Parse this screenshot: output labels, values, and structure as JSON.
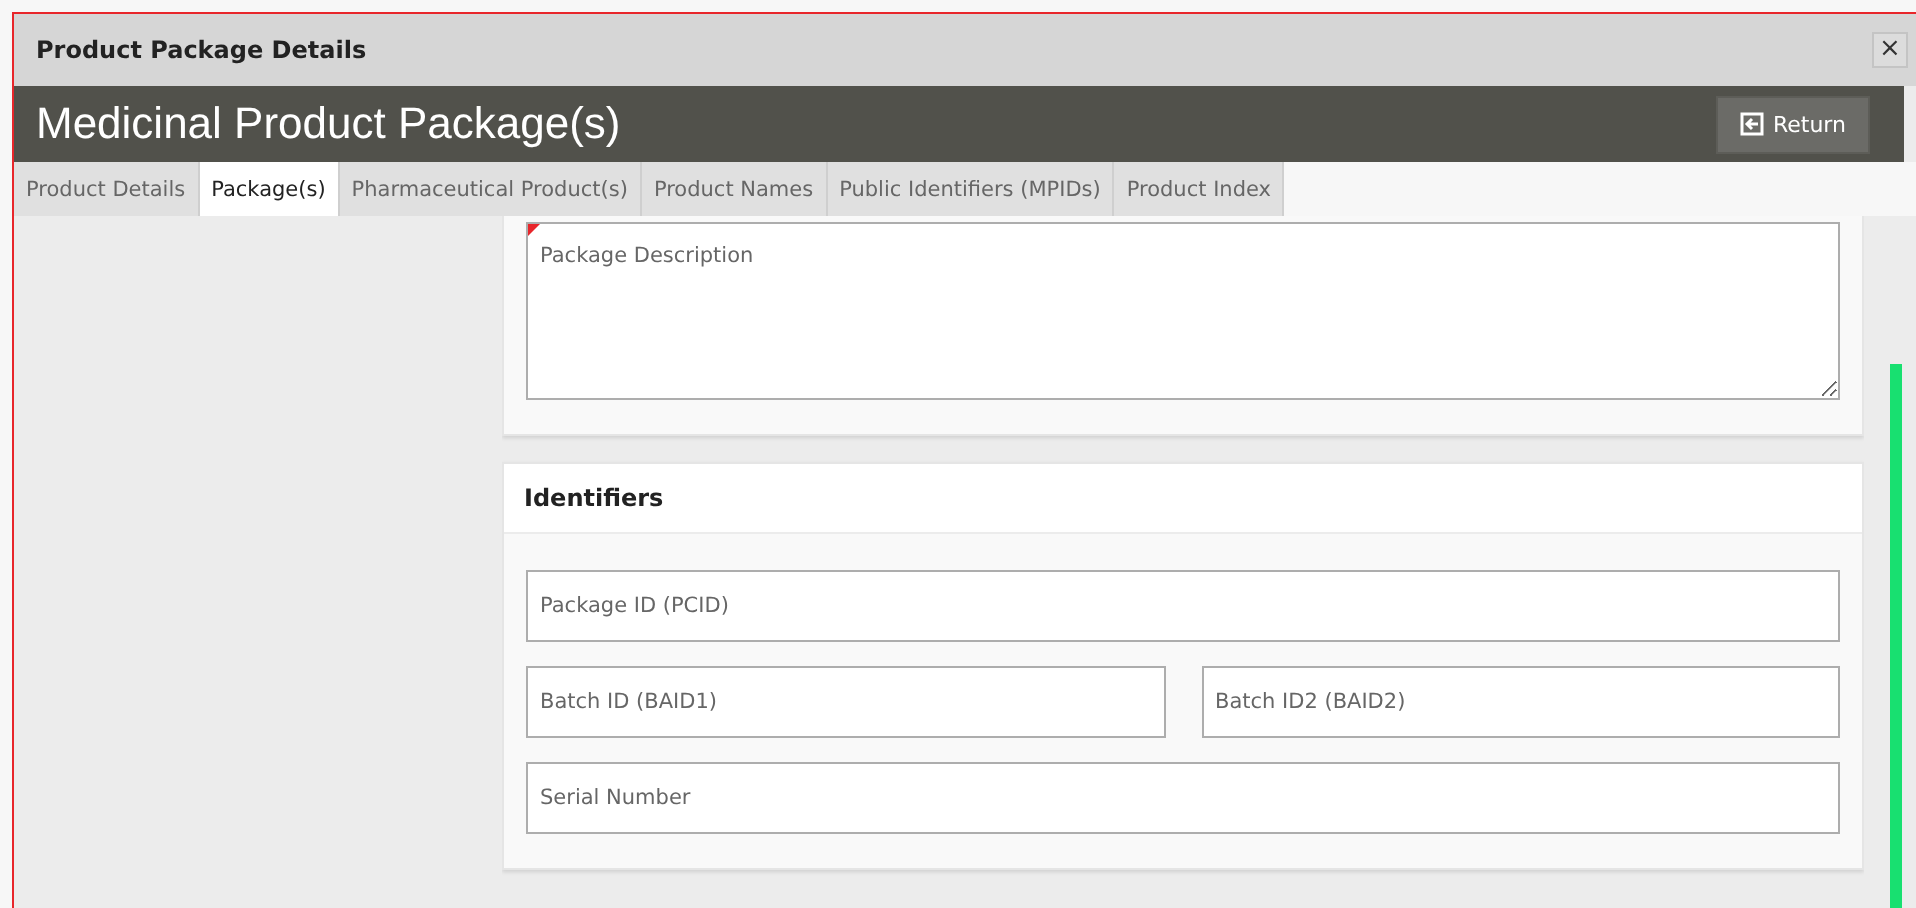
{
  "window": {
    "title": "Product Package Details",
    "close": "×"
  },
  "header": {
    "title": "Medicinal Product Package(s)",
    "button": "Return"
  },
  "tabs": [
    {
      "label": "Product Details",
      "selected": false
    },
    {
      "label": "Package(s)",
      "selected": true
    },
    {
      "label": "Pharmaceutical Product(s)",
      "selected": false
    },
    {
      "label": "Product Names",
      "selected": false
    },
    {
      "label": "Public Identifiers (MPIDs)",
      "selected": false
    },
    {
      "label": "Product Index",
      "selected": false
    }
  ],
  "description_card": {
    "field": {
      "placeholder": "Package Description",
      "required": true
    }
  },
  "identifiers_card": {
    "title": "Identifiers",
    "rows": [
      [
        {
          "placeholder": "Package ID (PCID)",
          "required": false
        }
      ],
      [
        {
          "placeholder": "Batch ID (BAID1)",
          "required": false
        },
        {
          "placeholder": "Batch ID2 (BAID2)",
          "required": false
        }
      ],
      [
        {
          "placeholder": "Serial Number",
          "required": false
        }
      ]
    ]
  }
}
